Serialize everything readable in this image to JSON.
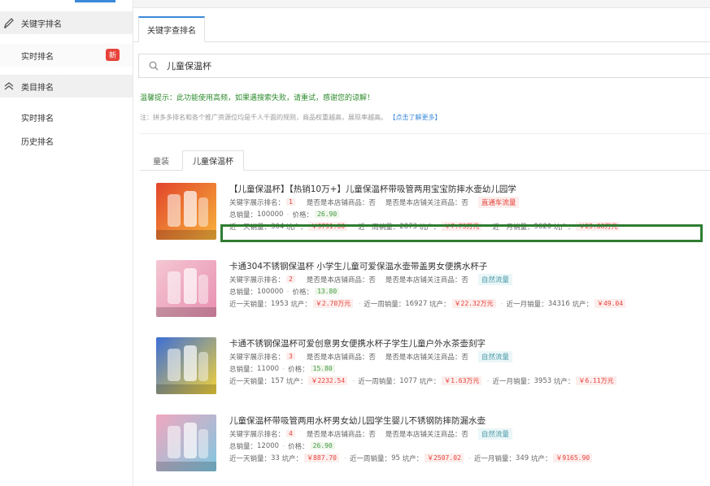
{
  "sidebar": {
    "groups": [
      {
        "label": "关键字排名",
        "icon": "pen-icon",
        "items": [
          {
            "label": "实时排名",
            "badge": "新"
          }
        ]
      },
      {
        "label": "类目排名",
        "icon": "chevron-double-up-icon",
        "items": [
          {
            "label": "实时排名"
          },
          {
            "label": "历史排名"
          }
        ]
      }
    ]
  },
  "main": {
    "tab_label": "关键字查排名",
    "search_value": "儿童保温杯",
    "tip": "温馨提示：此功能使用高频，如果遇搜索失败，请重试，感谢您的谅解！",
    "note": "注：拼多多排名和各个推广资源位均是千人千面的规则，商品权重越高，展现率越高。",
    "note_link": "【点击了解更多】",
    "kw_tabs": [
      "童装",
      "儿童保温杯"
    ]
  },
  "labels": {
    "rank": "关键字展示排名：",
    "is_own": "是否是本店铺商品：否",
    "is_follow": "是否是本店铺关注商品：否",
    "total_sales": "总销量：",
    "price": "价格：",
    "day_sales": "近一天销量：",
    "week_sales": "近一周销量：",
    "month_sales": "近一月销量：",
    "output": "坑产："
  },
  "products": [
    {
      "title": "【儿童保温杯】【热销10万+】儿童保温杯带吸管两用宝宝防摔水壶幼儿园学",
      "rank": "1",
      "tag": "直通车流量",
      "tag_type": "red",
      "total_sales": "100000",
      "price": "26.90",
      "day_sales": "364",
      "day_output": "￥9791.60",
      "week_sales": "2873",
      "week_output": "￥7.73万元",
      "month_sales": "9620",
      "month_output": "￥25.88万元",
      "img_colors": [
        "#e2452b",
        "#f7b33b"
      ]
    },
    {
      "title": "卡通304不锈钢保温杯 小学生儿童可爱保温水壶带盖男女便携水杯子",
      "rank": "2",
      "tag": "自然流量",
      "tag_type": "green",
      "total_sales": "100000",
      "price": "13.80",
      "day_sales": "1953",
      "day_output": "￥2.70万元",
      "week_sales": "16927",
      "week_output": "￥22.32万元",
      "month_sales": "34316",
      "month_output": "￥49.04",
      "img_colors": [
        "#f4c7d3",
        "#e88fb0"
      ]
    },
    {
      "title": "卡通不锈钢保温杯可爱创意男女便携水杯子学生儿童户外水茶壶刻字",
      "rank": "3",
      "tag": "自然流量",
      "tag_type": "green",
      "total_sales": "11000",
      "price": "15.80",
      "day_sales": "157",
      "day_output": "￥2232.54",
      "week_sales": "1077",
      "week_output": "￥1.63万元",
      "month_sales": "3953",
      "month_output": "￥6.11万元",
      "img_colors": [
        "#3d6fd6",
        "#f3d23a"
      ]
    },
    {
      "title": "儿童保温杯带吸管两用水杯男女幼儿园学生婴儿不锈钢防摔防漏水壶",
      "rank": "4",
      "tag": "自然流量",
      "tag_type": "green",
      "total_sales": "12000",
      "price": "26.90",
      "day_sales": "33",
      "day_output": "￥887.70",
      "week_sales": "95",
      "week_output": "￥2507.02",
      "month_sales": "349",
      "month_output": "￥9165.90",
      "img_colors": [
        "#f0a8c0",
        "#7fc7e0"
      ]
    }
  ]
}
